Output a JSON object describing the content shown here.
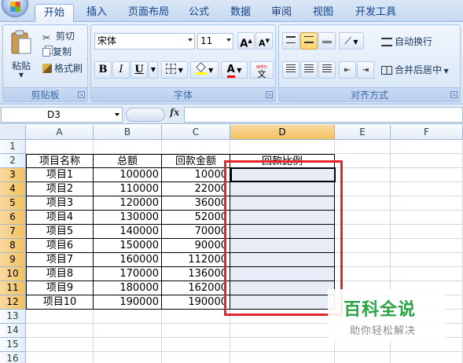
{
  "ribbon": {
    "tabs": [
      {
        "label": "开始",
        "active": true
      },
      {
        "label": "插入"
      },
      {
        "label": "页面布局"
      },
      {
        "label": "公式"
      },
      {
        "label": "数据"
      },
      {
        "label": "审阅"
      },
      {
        "label": "视图"
      },
      {
        "label": "开发工具"
      }
    ],
    "clipboard": {
      "paste_label": "粘贴",
      "cut_label": "剪切",
      "copy_label": "复制",
      "format_painter_label": "格式刷",
      "group_label": "剪贴板"
    },
    "font": {
      "font_name": "宋体",
      "font_size": "11",
      "grow_label": "A",
      "shrink_label": "A",
      "bold": "B",
      "italic": "I",
      "underline": "U",
      "font_color_label": "A",
      "phonetic_label": "wén",
      "phonetic_char": "文",
      "group_label": "字体"
    },
    "alignment": {
      "wrap_text_label": "自动换行",
      "merge_center_label": "合并后居中",
      "group_label": "对齐方式"
    }
  },
  "formula_bar": {
    "name_box": "D3",
    "fx": "fx",
    "formula": ""
  },
  "sheet": {
    "columns": [
      "A",
      "B",
      "C",
      "D",
      "E",
      "F"
    ],
    "selected_column": "D",
    "rows": [
      "1",
      "2",
      "3",
      "4",
      "5",
      "6",
      "7",
      "8",
      "9",
      "10",
      "11",
      "12",
      "13",
      "14",
      "15",
      "16"
    ],
    "selected_rows": [
      "3",
      "4",
      "5",
      "6",
      "7",
      "8",
      "9",
      "10",
      "11",
      "12"
    ],
    "headers": [
      "项目名称",
      "总额",
      "回款金额",
      "回款比例"
    ],
    "data": [
      [
        "项目1",
        "100000",
        "10000"
      ],
      [
        "项目2",
        "110000",
        "22000"
      ],
      [
        "项目3",
        "120000",
        "36000"
      ],
      [
        "项目4",
        "130000",
        "52000"
      ],
      [
        "项目5",
        "140000",
        "70000"
      ],
      [
        "项目6",
        "150000",
        "90000"
      ],
      [
        "项目7",
        "160000",
        "112000"
      ],
      [
        "项目8",
        "170000",
        "136000"
      ],
      [
        "项目9",
        "180000",
        "162000"
      ],
      [
        "项目10",
        "190000",
        "190000"
      ]
    ]
  },
  "watermark": {
    "title": "百科全说",
    "subtitle": "助你轻松解决"
  },
  "colors": {
    "highlight_box": "#e2262a",
    "selection_header": "#f1c15f",
    "watermark_green": "#2aa343"
  }
}
